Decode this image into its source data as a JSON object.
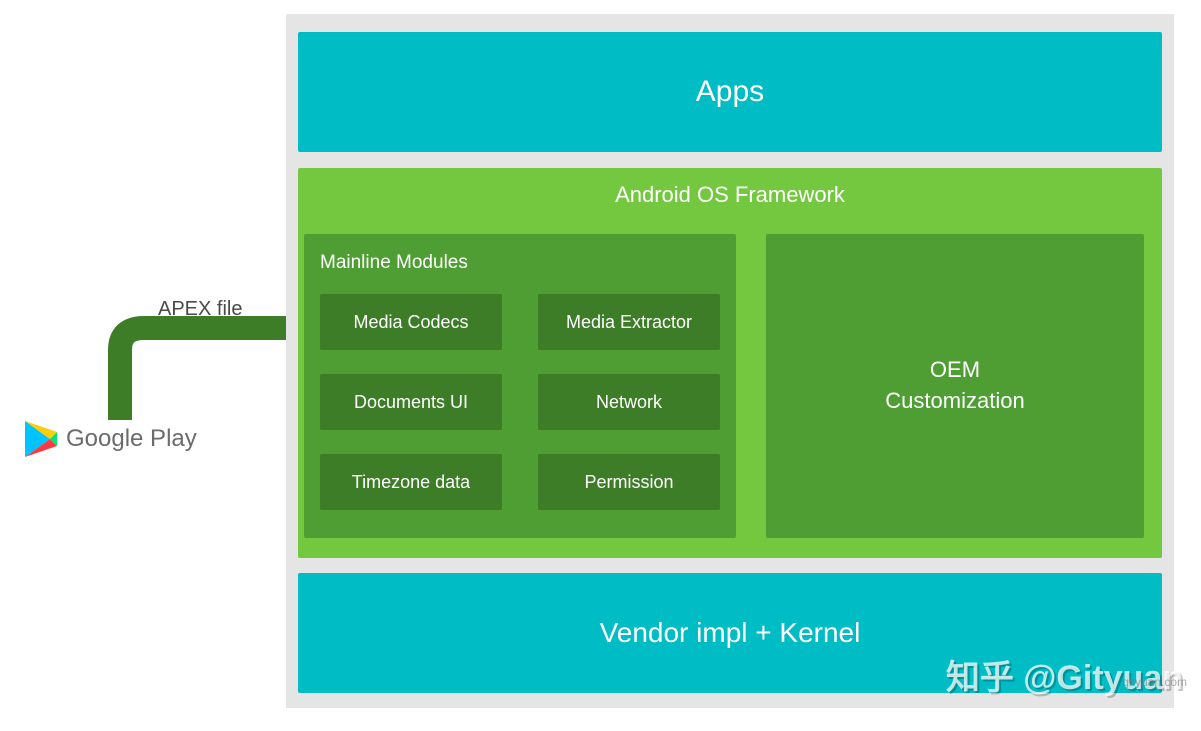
{
  "source": {
    "label": "Google Play"
  },
  "arrow": {
    "label": "APEX file"
  },
  "layers": {
    "apps": "Apps",
    "framework": {
      "title": "Android OS Framework",
      "mainline": {
        "title": "Mainline Modules",
        "modules": [
          "Media Codecs",
          "Media Extractor",
          "Documents UI",
          "Network",
          "Timezone data",
          "Permission"
        ]
      },
      "oem": {
        "line1": "OEM",
        "line2": "Customization"
      }
    },
    "vendor": "Vendor impl + Kernel"
  },
  "watermark": "知乎 @Gityuan",
  "colors": {
    "teal": "#00bcc4",
    "green_light": "#74c840",
    "green_mid": "#4f9e33",
    "green_dark": "#3d7d28",
    "stage_bg": "#e5e5e5"
  }
}
